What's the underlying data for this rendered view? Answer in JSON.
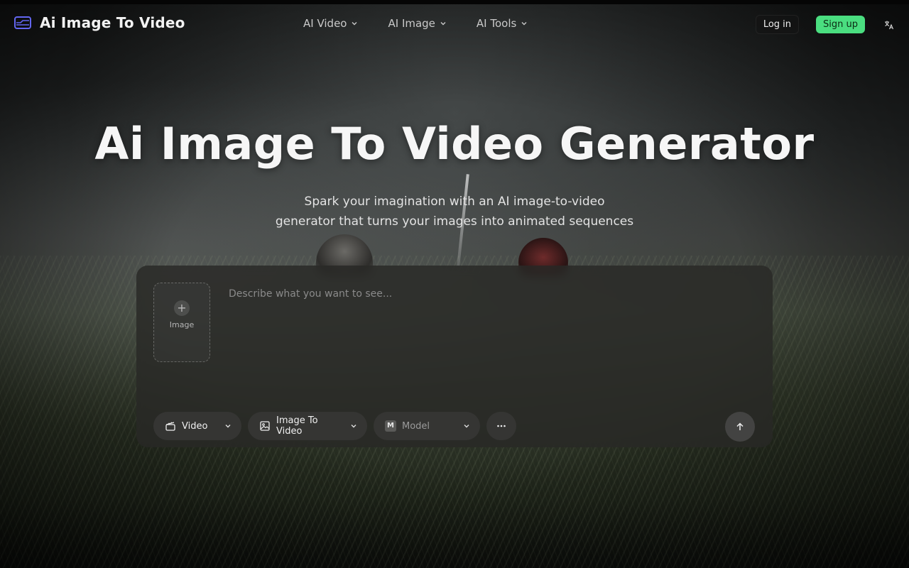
{
  "header": {
    "brand_name": "Ai Image To Video",
    "nav": [
      {
        "label": "AI Video"
      },
      {
        "label": "AI Image"
      },
      {
        "label": "AI Tools"
      }
    ],
    "login_label": "Log in",
    "signup_label": "Sign up"
  },
  "hero": {
    "title": "Ai Image To Video Generator",
    "subtitle_line1": "Spark your imagination with an AI image-to-video",
    "subtitle_line2": "generator that turns your images into animated sequences"
  },
  "composer": {
    "upload_label": "Image",
    "prompt_placeholder": "Describe what you want to see...",
    "type_label": "Video",
    "mode_label": "Image To Video",
    "model_badge": "M",
    "model_label": "Model"
  },
  "colors": {
    "accent_green": "#4ade80",
    "brand_icon": "#6366f1"
  },
  "icons": {
    "brand": "video-frame-icon",
    "chevron": "chevron-down-icon",
    "language": "translate-icon",
    "type": "clapperboard-icon",
    "mode": "image-icon",
    "more": "more-horizontal-icon",
    "send": "arrow-up-icon"
  }
}
